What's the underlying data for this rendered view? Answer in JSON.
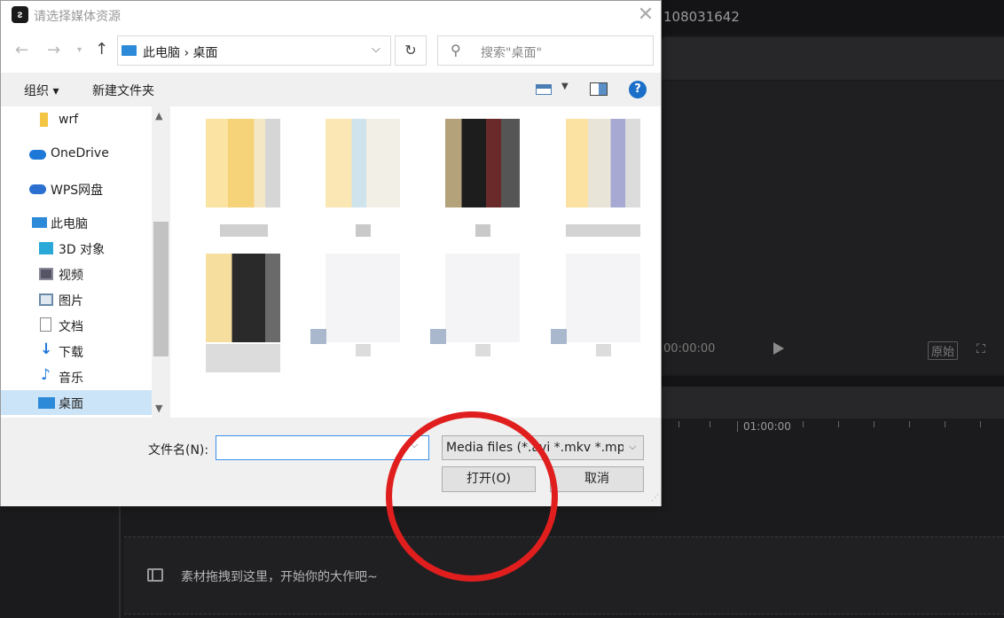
{
  "dialog": {
    "title": "请选择媒体资源",
    "address_path": "此电脑 › 桌面",
    "search_placeholder": "搜索\"桌面\"",
    "toolbar": {
      "organize": "组织 ▾",
      "new_folder": "新建文件夹"
    },
    "nav_items": [
      {
        "label": "wrf",
        "icon": "folder-icon"
      },
      {
        "label": "OneDrive",
        "icon": "cloud-icon"
      },
      {
        "label": "WPS网盘",
        "icon": "cloud-icon"
      },
      {
        "label": "此电脑",
        "icon": "computer-icon"
      },
      {
        "label": "3D 对象",
        "icon": "cube-icon"
      },
      {
        "label": "视频",
        "icon": "video-icon"
      },
      {
        "label": "图片",
        "icon": "image-icon"
      },
      {
        "label": "文档",
        "icon": "document-icon"
      },
      {
        "label": "下载",
        "icon": "download-icon"
      },
      {
        "label": "音乐",
        "icon": "music-icon"
      },
      {
        "label": "桌面",
        "icon": "desktop-icon"
      }
    ],
    "filename_label": "文件名(N):",
    "filename_value": "",
    "file_type": "Media files (*.avi *.mkv *.mpg",
    "open_button": "打开(O)",
    "cancel_button": "取消"
  },
  "app": {
    "id_text": "108031642",
    "preview_time": "00:00:00",
    "ratio_label": "原始",
    "ruler_label": "01:00:00",
    "track_hint": "素材拖拽到这里，开始你的大作吧~"
  },
  "colors": {
    "accent": "#1c6fc9",
    "selected": "#cce4f7",
    "highlight_circle": "#e01e1e"
  }
}
